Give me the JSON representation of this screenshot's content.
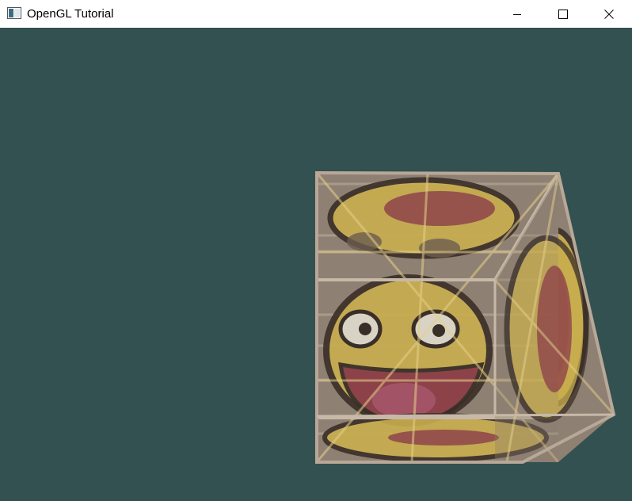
{
  "window": {
    "title": "OpenGL Tutorial",
    "icon": "app-window-icon",
    "buttons": {
      "minimize": "minimize-icon",
      "maximize": "maximize-icon",
      "close": "close-icon"
    }
  },
  "viewport": {
    "clear_color": "#335150",
    "scene": "textured-cube",
    "cube_colors": {
      "wood": "#8e8073",
      "wood_light": "#b0a18f",
      "face_yellow": "#c9ae4e",
      "mouth_red": "#8b3d4a",
      "outline": "#3a2f28"
    }
  }
}
